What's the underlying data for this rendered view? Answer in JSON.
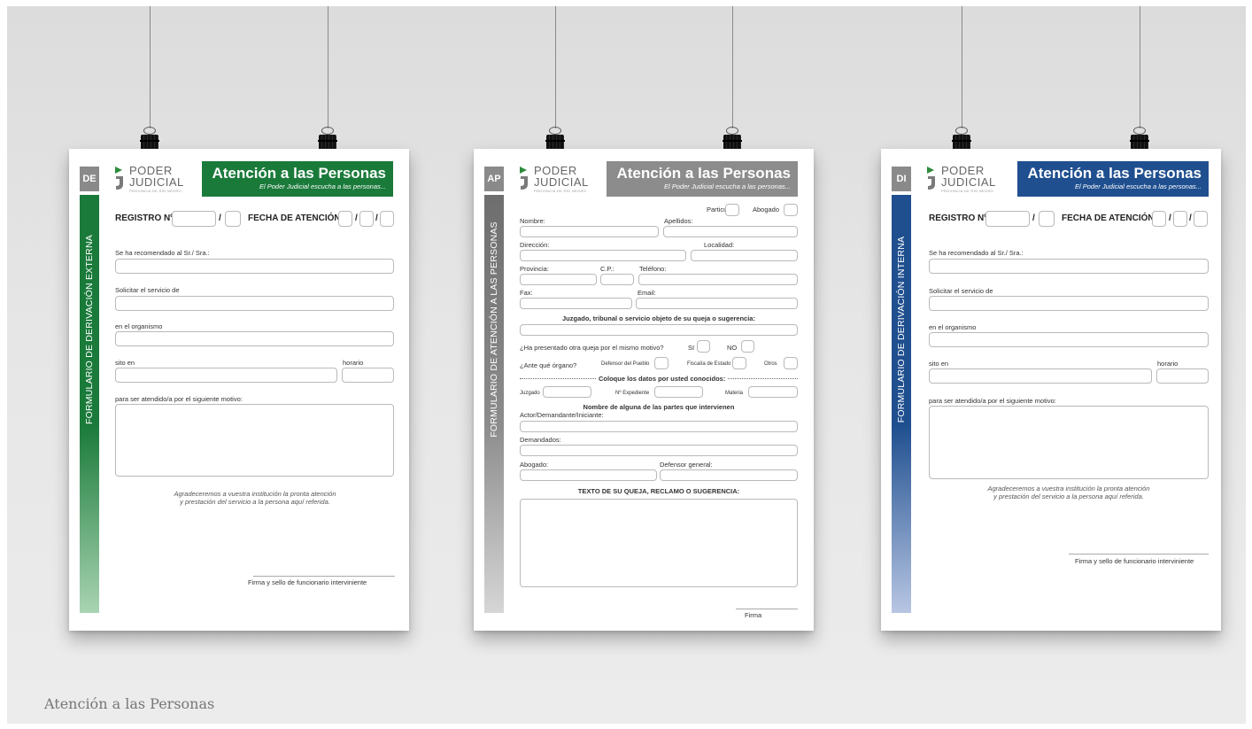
{
  "caption": "Atención a las Personas",
  "logo": {
    "line1": "PODER",
    "line2": "JUDICIAL",
    "line3": "PROVINCIA DE RÍO NEGRO"
  },
  "banner": {
    "title": "Atención a las Personas",
    "subtitle": "El Poder Judicial escucha a las personas..."
  },
  "colors": {
    "green": "#1a7a3a",
    "gray": "#8c8c8c",
    "blue": "#1f4f8f",
    "logo_green": "#2e8b3d"
  },
  "form_de": {
    "code": "DE",
    "vertical_title": "FORMULARIO DE DERIVACIÓN EXTERNA",
    "registro": "REGISTRO Nº",
    "slash": "/",
    "fecha": "FECHA DE ATENCIÓN",
    "recomendado": "Se ha recomendado al Sr./ Sra.:",
    "solicitar": "Solicitar el servicio de",
    "organismo": "en el organismo",
    "sito": "sito en",
    "horario": "horario",
    "motivo": "para ser atendido/a por el siguiente motivo:",
    "note1": "Agradeceremos a vuestra institución la pronta atención",
    "note2": "y prestación del servicio a la persona aquí referida.",
    "firma": "Firma y sello de funcionario interviniente"
  },
  "form_ap": {
    "code": "AP",
    "vertical_title": "FORMULARIO DE ATENCIÓN A LAS PERSONAS",
    "particular": "Particular",
    "abogado_chk": "Abogado",
    "nombre": "Nombre:",
    "apellidos": "Apellidos:",
    "direccion": "Dirección:",
    "localidad": "Localidad:",
    "provincia": "Provincia:",
    "cp": "C.P.:",
    "telefono": "Teléfono:",
    "fax": "Fax:",
    "email": "Email:",
    "juzgado_hdr": "Juzgado, tribunal o servicio objeto de su queja o sugerencia:",
    "otra_queja": "¿Ha presentado otra queja por el mismo motivo?",
    "si": "SI",
    "no": "NO",
    "ante": "¿Ante qué órgano?",
    "defensor_pueblo": "Defensor del Pueblo",
    "fiscalia": "Fiscalía de Estado",
    "otros": "Otros",
    "coloque": "Coloque los datos por usted conocidos:",
    "juzgado": "Juzgado",
    "expediente": "Nº Expediente",
    "materia": "Materia",
    "partes_hdr": "Nombre de alguna de las partes que intervienen",
    "actor": "Actor/Demandante/Iniciante:",
    "demandados": "Demandados:",
    "abogado": "Abogado:",
    "defensor_general": "Defensor general:",
    "texto_hdr": "TEXTO DE SU QUEJA, RECLAMO O SUGERENCIA:",
    "firma": "Firma"
  },
  "form_di": {
    "code": "DI",
    "vertical_title": "FORMULARIO DE DERIVACIÓN INTERNA",
    "registro": "REGISTRO Nº",
    "slash": "/",
    "fecha": "FECHA DE ATENCIÓN",
    "recomendado": "Se ha recomendado al Sr./ Sra.:",
    "solicitar": "Solicitar el servicio de",
    "organismo": "en el organismo",
    "sito": "sito en",
    "horario": "horario",
    "motivo": "para ser atendido/a por el siguiente motivo:",
    "note1": "Agradeceremos a vuestra institución la pronta atención",
    "note2": "y prestación del servicio a la persona aquí referida.",
    "firma": "Firma y sello de funcionario interviniente"
  }
}
